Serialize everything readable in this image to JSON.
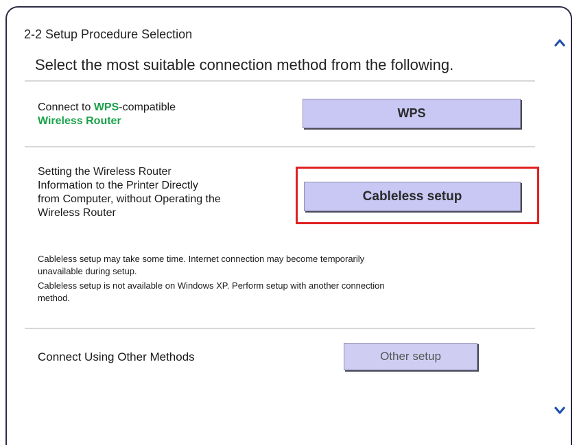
{
  "panel": {
    "step_title": "2-2 Setup Procedure Selection",
    "instruction": "Select the most suitable connection method from the following."
  },
  "options": {
    "wps": {
      "desc_prefix": "Connect to ",
      "desc_highlight": "WPS",
      "desc_suffix": "-compatible",
      "desc_line2": "Wireless Router",
      "button_label": "WPS"
    },
    "cableless": {
      "desc_lines": [
        "Setting the Wireless Router",
        "Information to the Printer Directly",
        "from Computer, without Operating the",
        "Wireless Router"
      ],
      "button_label": "Cableless setup"
    },
    "notes": [
      "Cableless setup may take some time. Internet connection may become temporarily",
      "unavailable during setup.",
      "Cableless setup is not available on Windows XP. Perform setup with another connection",
      "method."
    ],
    "other": {
      "desc": "Connect Using Other Methods",
      "button_label": "Other setup"
    }
  },
  "colors": {
    "accent_green": "#1aa34a",
    "button_fill": "#c9c8f4",
    "highlight_red": "#e02020",
    "arrow_blue": "#1f4fb0"
  },
  "icons": {
    "scroll_up": "chevron-up-icon",
    "scroll_down": "chevron-down-icon"
  }
}
